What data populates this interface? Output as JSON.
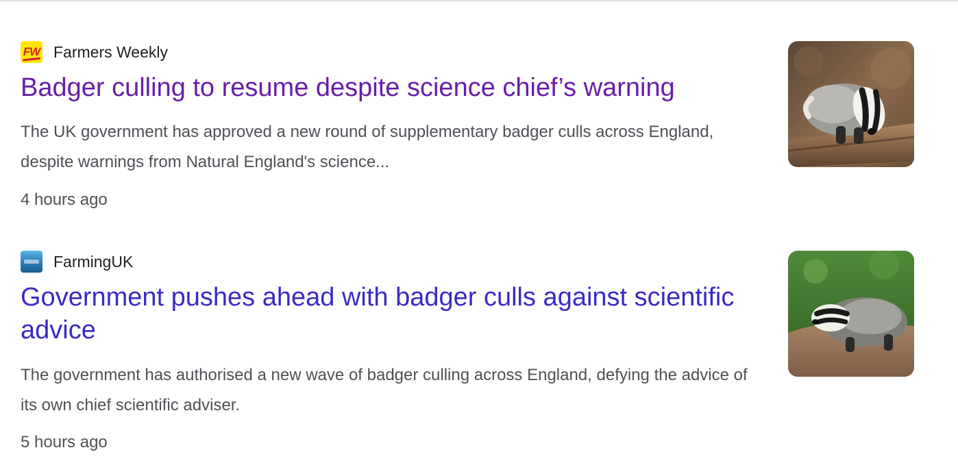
{
  "articles": [
    {
      "source": "Farmers Weekly",
      "favicon_text": "FW",
      "favicon_icon": "farmers-weekly-logo-icon",
      "title": "Badger culling to resume despite science chief’s warning",
      "snippet": "The UK government has approved a new round of supplementary badger culls across England, despite warnings from Natural England's science...",
      "time": "4 hours ago",
      "title_color": "#681da8",
      "thumbnail": "badger-on-log-photo"
    },
    {
      "source": "FarmingUK",
      "favicon_icon": "farminguk-logo-icon",
      "title": "Government pushes ahead with badger culls against scientific advice",
      "snippet": "The government has authorised a new wave of badger culling across England, defying the advice of its own chief scientific adviser.",
      "time": "5 hours ago",
      "title_color": "#3a2bc4",
      "thumbnail": "badger-on-grass-photo"
    }
  ]
}
